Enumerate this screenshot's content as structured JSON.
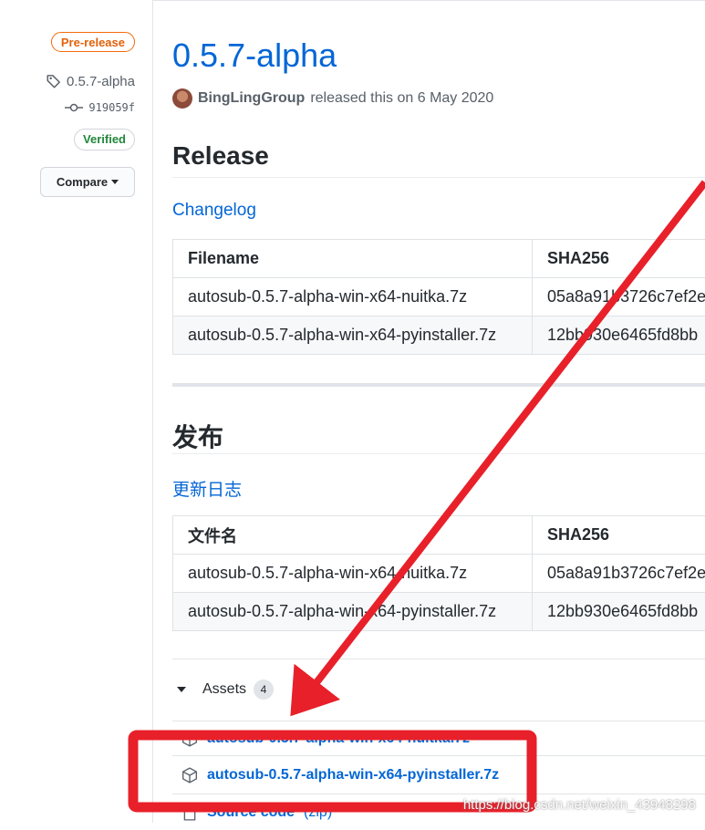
{
  "sidebar": {
    "prerelease_badge": "Pre-release",
    "tag": "0.5.7-alpha",
    "commit": "919059f",
    "verified": "Verified",
    "compare_label": "Compare"
  },
  "release": {
    "title": "0.5.7-alpha",
    "author": "BingLingGroup",
    "released_text": "released this on 6 May 2020"
  },
  "section_en": {
    "heading": "Release",
    "changelog_link": "Changelog",
    "table": {
      "headers": [
        "Filename",
        "SHA256"
      ],
      "rows": [
        [
          "autosub-0.5.7-alpha-win-x64-nuitka.7z",
          "05a8a91b3726c7ef2e"
        ],
        [
          "autosub-0.5.7-alpha-win-x64-pyinstaller.7z",
          "12bb930e6465fd8bb"
        ]
      ]
    }
  },
  "section_zh": {
    "heading": "发布",
    "changelog_link": "更新日志",
    "table": {
      "headers": [
        "文件名",
        "SHA256"
      ],
      "rows": [
        [
          "autosub-0.5.7-alpha-win-x64-nuitka.7z",
          "05a8a91b3726c7ef2e"
        ],
        [
          "autosub-0.5.7-alpha-win-x64-pyinstaller.7z",
          "12bb930e6465fd8bb"
        ]
      ]
    }
  },
  "assets": {
    "label": "Assets",
    "count": "4",
    "items": [
      {
        "name": "autosub-0.5.7-alpha-win-x64-nuitka.7z"
      },
      {
        "name": "autosub-0.5.7-alpha-win-x64-pyinstaller.7z"
      },
      {
        "name": "Source code",
        "suffix": "(zip)"
      }
    ]
  },
  "annotation": {
    "color": "#e8202a"
  },
  "watermark": "https://blog.csdn.net/weixin_43948298"
}
